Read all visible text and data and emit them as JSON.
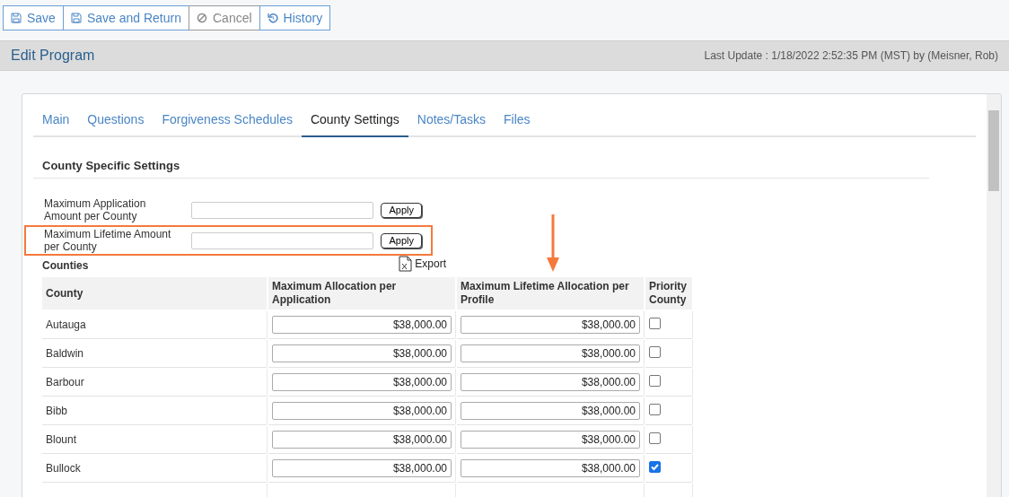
{
  "toolbar": [
    {
      "label": "Save",
      "kind": "save",
      "disabled": false
    },
    {
      "label": "Save and Return",
      "kind": "save",
      "disabled": false
    },
    {
      "label": "Cancel",
      "kind": "cancel",
      "disabled": true
    },
    {
      "label": "History",
      "kind": "history",
      "disabled": false
    }
  ],
  "header": {
    "title": "Edit Program",
    "last_update": "Last Update : 1/18/2022 2:52:35 PM (MST) by (Meisner, Rob)"
  },
  "tabs": [
    {
      "label": "Main",
      "selected": false
    },
    {
      "label": "Questions",
      "selected": false
    },
    {
      "label": "Forgiveness Schedules",
      "selected": false
    },
    {
      "label": "County Settings",
      "selected": true
    },
    {
      "label": "Notes/Tasks",
      "selected": false
    },
    {
      "label": "Files",
      "selected": false
    }
  ],
  "section_title": "County Specific Settings",
  "settings": [
    {
      "label": "Maximum Application Amount per County",
      "button": "Apply",
      "highlighted": false
    },
    {
      "label": "Maximum Lifetime Amount per County",
      "button": "Apply",
      "highlighted": true
    }
  ],
  "counties_title": "Counties",
  "export": "Export",
  "table": {
    "columns": [
      {
        "label": "County",
        "marked": false
      },
      {
        "label": "Maximum Allocation per Application",
        "marked": false
      },
      {
        "label": "Maximum Lifetime Allocation per Profile",
        "marked": true
      },
      {
        "label": "Priority County",
        "marked": false
      }
    ],
    "rows": [
      {
        "county": "Autauga",
        "allocation": "$38,000.00",
        "lifetime": "$38,000.00",
        "priority": false
      },
      {
        "county": "Baldwin",
        "allocation": "$38,000.00",
        "lifetime": "$38,000.00",
        "priority": false
      },
      {
        "county": "Barbour",
        "allocation": "$38,000.00",
        "lifetime": "$38,000.00",
        "priority": false
      },
      {
        "county": "Bibb",
        "allocation": "$38,000.00",
        "lifetime": "$38,000.00",
        "priority": false
      },
      {
        "county": "Blount",
        "allocation": "$38,000.00",
        "lifetime": "$38,000.00",
        "priority": false
      },
      {
        "county": "Bullock",
        "allocation": "$38,000.00",
        "lifetime": "$38,000.00",
        "priority": true
      }
    ]
  }
}
